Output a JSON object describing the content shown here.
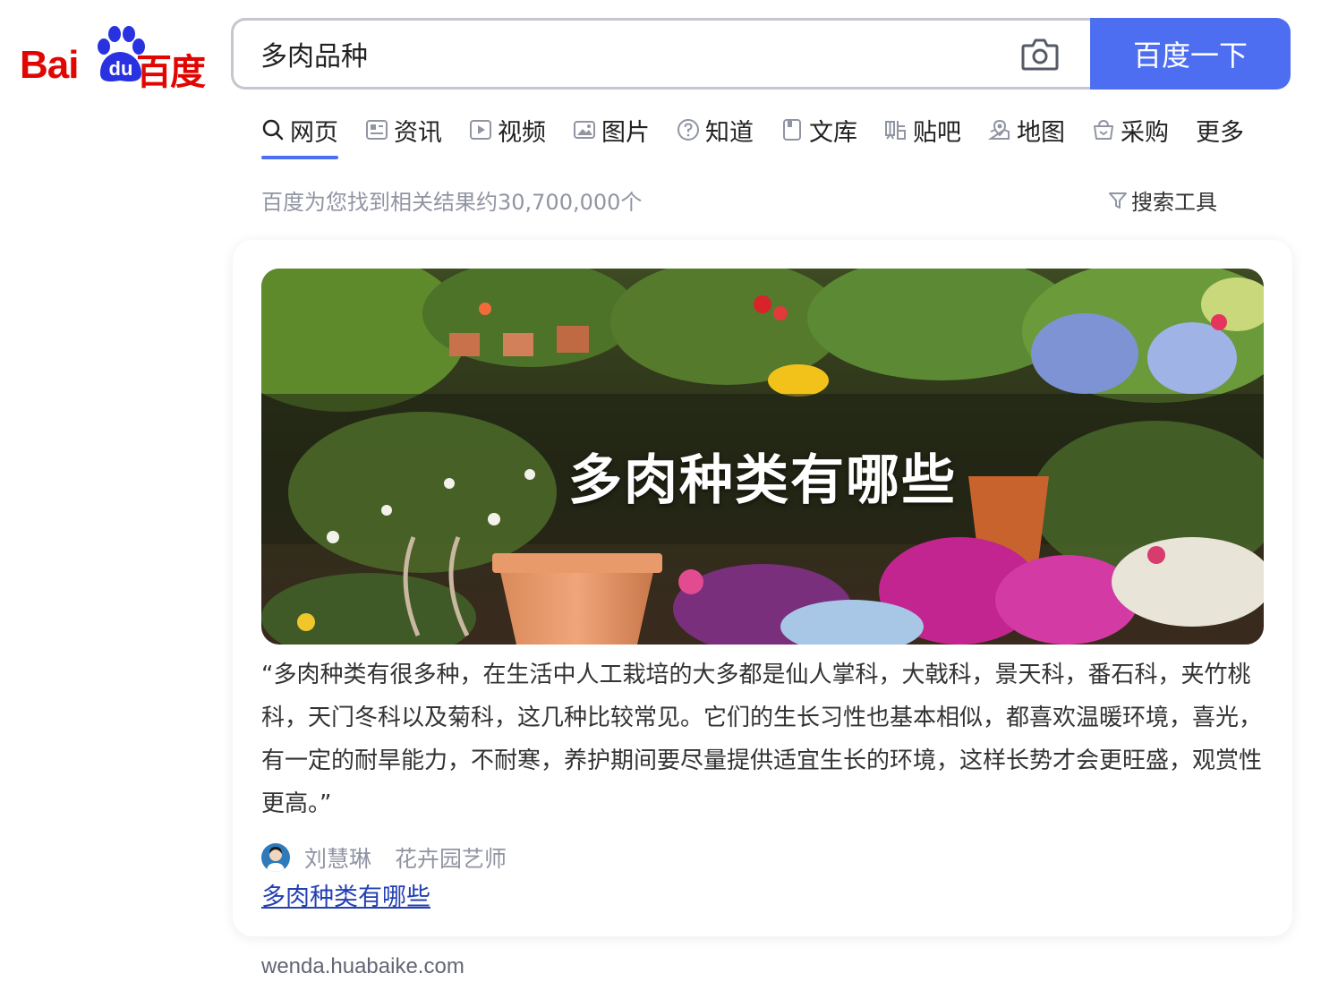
{
  "logo": {
    "text_latin": "Bai",
    "text_du": "du",
    "text_cn": "百度",
    "color": "#e10602",
    "paw_color": "#2932e1"
  },
  "search": {
    "query": "多肉品种",
    "button_label": "百度一下",
    "accent": "#4e6ef2"
  },
  "tabs": [
    {
      "label": "网页",
      "icon": "search-icon",
      "active": true
    },
    {
      "label": "资讯",
      "icon": "news-icon"
    },
    {
      "label": "视频",
      "icon": "video-icon"
    },
    {
      "label": "图片",
      "icon": "image-icon"
    },
    {
      "label": "知道",
      "icon": "question-icon"
    },
    {
      "label": "文库",
      "icon": "doc-icon"
    },
    {
      "label": "贴吧",
      "icon": "tieba-icon"
    },
    {
      "label": "地图",
      "icon": "map-icon"
    },
    {
      "label": "采购",
      "icon": "shopping-icon"
    },
    {
      "label": "更多"
    }
  ],
  "result_count": "百度为您找到相关结果约30,700,000个",
  "search_tools": "搜索工具",
  "card": {
    "banner_title": "多肉种类有哪些",
    "quote": "“多肉种类有很多种，在生活中人工栽培的大多都是仙人掌科，大戟科，景天科，番石科，夹竹桃科，天门冬科以及菊科，这几种比较常见。它们的生长习性也基本相似，都喜欢温暖环境，喜光，有一定的耐旱能力，不耐寒，养护期间要尽量提供适宜生长的环境，这样长势才会更旺盛，观赏性更高。”",
    "author_name": "刘慧琳",
    "author_title": "花卉园艺师",
    "link_text": "多肉种类有哪些"
  },
  "source": "wenda.huabaike.com"
}
